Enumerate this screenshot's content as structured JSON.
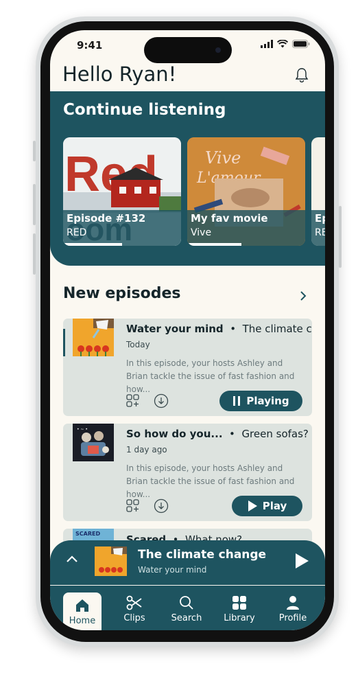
{
  "status": {
    "time": "9:41"
  },
  "header": {
    "greeting": "Hello Ryan!"
  },
  "continue_listening": {
    "title": "Continue listening",
    "cards": [
      {
        "episode": "Episode #132",
        "show": "RED",
        "progress": 0.5
      },
      {
        "episode": "My fav movie",
        "show": "Vive",
        "progress": 0.46
      },
      {
        "episode": "Ep",
        "show": "RE",
        "progress": 0.0
      }
    ]
  },
  "new_episodes": {
    "title": "New episodes",
    "items": [
      {
        "title": "Water your mind",
        "show": "The climate c",
        "date": "Today",
        "description": "In this episode, your hosts Ashley and Brian tackle the issue of fast fashion and how...",
        "button": "Playing",
        "state": "playing"
      },
      {
        "title": "So how do you...",
        "show": "Green sofas?",
        "date": "1 day ago",
        "description": "In this episode, your hosts Ashley and Brian tackle the issue of fast fashion and how...",
        "button": "Play",
        "state": "paused"
      },
      {
        "title": "Scared",
        "show": "What now?"
      }
    ]
  },
  "mini_player": {
    "title": "The climate change",
    "subtitle": "Water your mind"
  },
  "nav": {
    "items": [
      {
        "label": "Home",
        "icon": "home-icon",
        "active": true
      },
      {
        "label": "Clips",
        "icon": "scissors-icon"
      },
      {
        "label": "Search",
        "icon": "search-icon"
      },
      {
        "label": "Library",
        "icon": "library-icon"
      },
      {
        "label": "Profile",
        "icon": "profile-icon"
      }
    ]
  },
  "colors": {
    "primary": "#1e5460",
    "background": "#fbf8f1",
    "card": "#dde3df",
    "text": "#15252a"
  }
}
